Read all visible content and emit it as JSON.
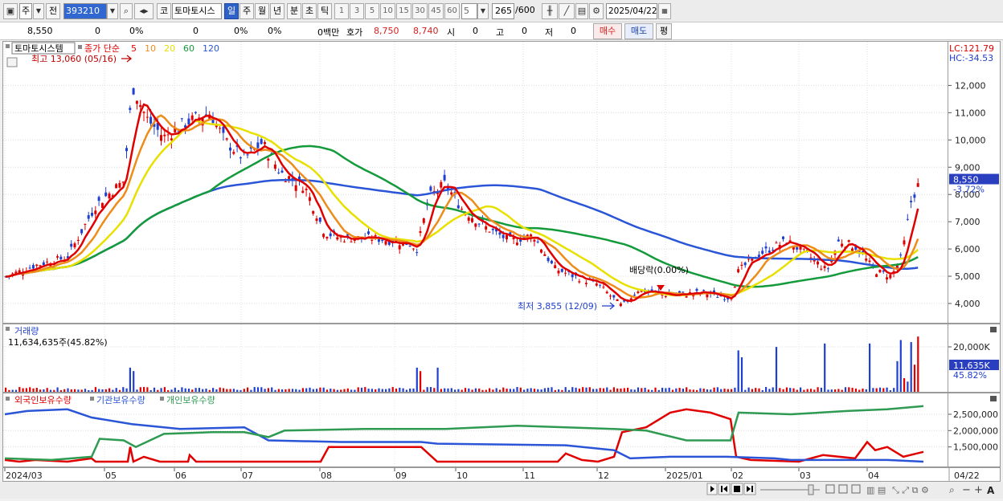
{
  "toolbar": {
    "type": "주",
    "prev": "전",
    "code": "393210",
    "kor_btn": "코",
    "name": "토마토시스",
    "periods": [
      "일",
      "주",
      "월",
      "년",
      "분",
      "초",
      "틱"
    ],
    "nums": [
      "1",
      "3",
      "5",
      "10",
      "15",
      "30",
      "45",
      "60"
    ],
    "count_sel": "5",
    "count": "265",
    "total": "/600",
    "date": "2025/04/22"
  },
  "quote": {
    "price": "8,550",
    "change": "0",
    "pct1": "0%",
    "vol": "0",
    "pct2": "0%",
    "pct3": "0%",
    "amount": "0백만",
    "hoga": "호가",
    "ask": "8,750",
    "bid": "8,740",
    "open_l": "시",
    "open_v": "0",
    "high_l": "고",
    "high_v": "0",
    "low_l": "저",
    "low_v": "0",
    "buy": "매수",
    "sell": "매도",
    "eval": "평"
  },
  "chart": {
    "stock_name": "토마토시스템",
    "ma_label": "종가 단순",
    "ma_periods": [
      {
        "label": "5",
        "color": "#e00000"
      },
      {
        "label": "10",
        "color": "#ee8c1a"
      },
      {
        "label": "20",
        "color": "#e8e000"
      },
      {
        "label": "60",
        "color": "#139a3a"
      },
      {
        "label": "120",
        "color": "#2a55d6"
      }
    ],
    "high_note": "최고 13,060 (05/16)",
    "low_note": "최저 3,855 (12/09)",
    "dividend_note": "배당락(0.00%)",
    "lc": "LC:121.79",
    "hc": "HC:-34.53",
    "last_price": "8,550",
    "last_pct": "-3.72%",
    "price_ticks": [
      "12,000",
      "11,000",
      "10,000",
      "9,000",
      "8,000",
      "7,000",
      "6,000",
      "5,000",
      "4,000"
    ]
  },
  "volume": {
    "label": "거래량",
    "value": "11,634,635주(45.82%)",
    "ticks": [
      "20,000K"
    ],
    "last": "11,635K",
    "last_pct": "45.82%"
  },
  "holdings": {
    "label_foreign": "외국인보유수량",
    "label_inst": "기관보유수량",
    "label_retail": "개인보유수량",
    "ticks": [
      "2,500,000",
      "2,000,000",
      "1,500,000"
    ]
  },
  "xaxis": {
    "labels": [
      "2024/03",
      "05",
      "06",
      "07",
      "08",
      "09",
      "10",
      "11",
      "12",
      "2025/01",
      "02",
      "03",
      "04"
    ],
    "last": "04/22"
  },
  "chart_data": {
    "type": "candlestick",
    "x_dates": [
      "2024/03",
      "05",
      "06",
      "07",
      "08",
      "09",
      "10",
      "11",
      "12",
      "2025/01",
      "02",
      "03",
      "04",
      "04/22"
    ],
    "price_range": [
      3600,
      13300
    ],
    "close_path": [
      [
        "2024/03",
        4950
      ],
      [
        "2024/04",
        5700
      ],
      [
        "2024/05",
        8500
      ],
      [
        "2024/05/16",
        12000
      ],
      [
        "2024/06",
        10100
      ],
      [
        "2024/06/20",
        11000
      ],
      [
        "2024/07",
        9300
      ],
      [
        "2024/07/10",
        9900
      ],
      [
        "2024/07/20",
        8800
      ],
      [
        "2024/08",
        6500
      ],
      [
        "2024/09",
        6400
      ],
      [
        "2024/09/20",
        8400
      ],
      [
        "2024/10",
        7500
      ],
      [
        "2024/10/20",
        6300
      ],
      [
        "2024/11",
        6500
      ],
      [
        "2024/11/20",
        5000
      ],
      [
        "2024/12/09",
        3855
      ],
      [
        "2024/12/20",
        4500
      ],
      [
        "2025/01",
        4350
      ],
      [
        "2025/02",
        4200
      ],
      [
        "2025/02/15",
        5800
      ],
      [
        "2025/03",
        5700
      ],
      [
        "2025/03/15",
        6300
      ],
      [
        "2025/04",
        5000
      ],
      [
        "2025/04/15",
        7800
      ],
      [
        "2025/04/22",
        8550
      ]
    ],
    "ma60_path": [
      4500,
      5300,
      8300,
      9700,
      8500,
      6900,
      6500,
      5200,
      4700,
      4900,
      5800
    ],
    "ma120_path": [
      4400,
      5000,
      6700,
      8300,
      8400,
      7000,
      5600,
      5300,
      5400
    ],
    "volume_max_k": 22000,
    "volume_last_k": 11635,
    "holdings": {
      "foreign": [
        1050000,
        1500000,
        1050000,
        1050000,
        1050000,
        2000000,
        2500000,
        2300000,
        1150000,
        1500000,
        1300000
      ],
      "institution": [
        2550000,
        2100000,
        2000000,
        1700000,
        1600000,
        1400000,
        1150000,
        1100000,
        1050000
      ],
      "retail": [
        1100000,
        1900000,
        1950000,
        2100000,
        2200000,
        1950000,
        1800000,
        2600000,
        2700000
      ]
    }
  }
}
